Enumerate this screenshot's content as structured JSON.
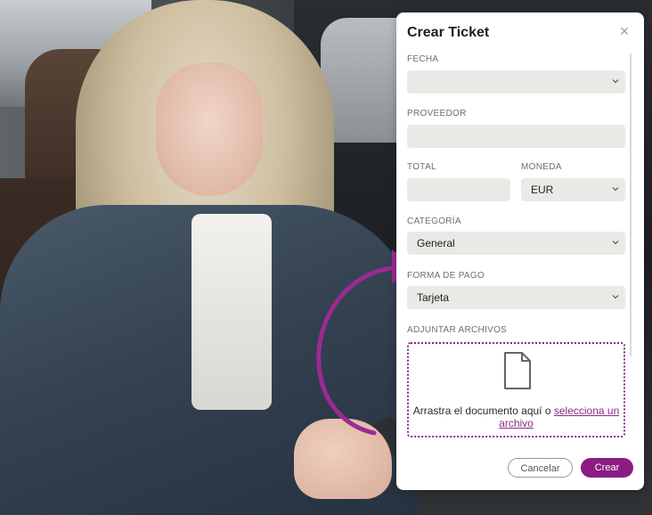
{
  "modal": {
    "title": "Crear Ticket",
    "close_icon": "close-icon"
  },
  "form": {
    "fecha": {
      "label": "FECHA",
      "value": ""
    },
    "proveedor": {
      "label": "PROVEEDOR",
      "value": ""
    },
    "total": {
      "label": "TOTAL",
      "value": ""
    },
    "moneda": {
      "label": "MONEDA",
      "value": "EUR"
    },
    "categoria": {
      "label": "CATEGORÍA",
      "value": "General"
    },
    "forma_pago": {
      "label": "FORMA DE PAGO",
      "value": "Tarjeta"
    },
    "adjuntar": {
      "label": "ADJUNTAR ARCHIVOS",
      "text": "Arrastra el documento aquí o",
      "link": "selecciona un archivo",
      "icon": "document-icon"
    }
  },
  "actions": {
    "cancel_label": "Cancelar",
    "create_label": "Crear"
  },
  "colors": {
    "accent": "#8b1d82",
    "field_bg": "#ebe9e6",
    "arrow": "#9b2a93"
  }
}
